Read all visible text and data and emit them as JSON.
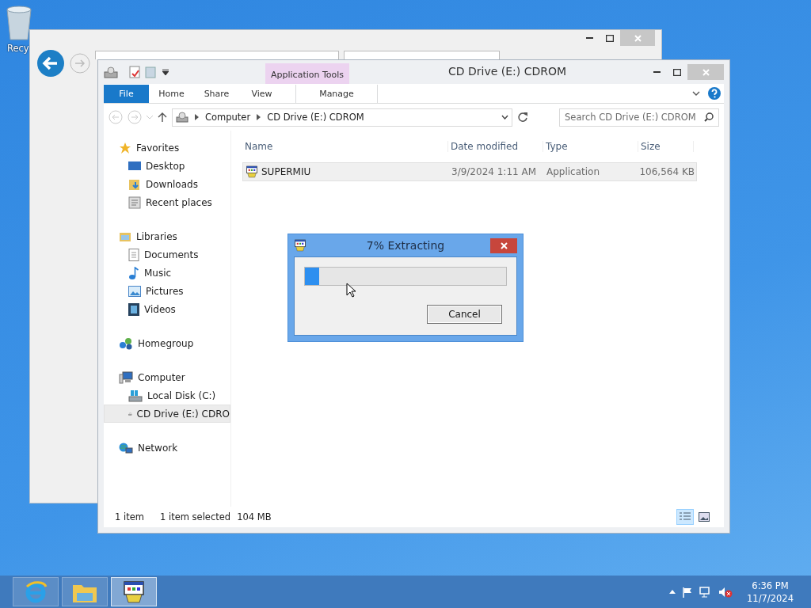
{
  "desktop": {
    "icon_label": "Recy"
  },
  "explorer": {
    "title": "CD Drive (E:) CDROM",
    "context_group": "Application Tools",
    "ribbon_tabs": [
      {
        "label": "File",
        "kind": "file"
      },
      {
        "label": "Home",
        "kind": "tab"
      },
      {
        "label": "Share",
        "kind": "tab"
      },
      {
        "label": "View",
        "kind": "tab"
      },
      {
        "label": "Manage",
        "kind": "contextual"
      }
    ],
    "path": [
      "Computer",
      "CD Drive (E:) CDROM"
    ],
    "search": {
      "placeholder": "Search CD Drive (E:) CDROM"
    },
    "columns": [
      "Name",
      "Date modified",
      "Type",
      "Size"
    ],
    "rows": [
      {
        "name": "SUPERMIU",
        "date": "3/9/2024 1:11 AM",
        "type": "Application",
        "size": "106,564 KB",
        "selected": true
      }
    ],
    "sidebar": [
      {
        "label": "Favorites",
        "kind": "star",
        "selected": false,
        "children": [
          {
            "label": "Desktop",
            "kind": "desktop",
            "selected": false
          },
          {
            "label": "Downloads",
            "kind": "downloads",
            "selected": false
          },
          {
            "label": "Recent places",
            "kind": "recent",
            "selected": false
          }
        ]
      },
      {
        "label": "Libraries",
        "kind": "library",
        "selected": false,
        "children": [
          {
            "label": "Documents",
            "kind": "document",
            "selected": false
          },
          {
            "label": "Music",
            "kind": "music",
            "selected": false
          },
          {
            "label": "Pictures",
            "kind": "pictures",
            "selected": false
          },
          {
            "label": "Videos",
            "kind": "videos",
            "selected": false
          }
        ]
      },
      {
        "label": "Homegroup",
        "kind": "homegroup",
        "selected": false
      },
      {
        "label": "Computer",
        "kind": "computer",
        "selected": false,
        "children": [
          {
            "label": "Local Disk (C:)",
            "kind": "disk",
            "selected": false
          },
          {
            "label": "CD Drive (E:) CDRO",
            "kind": "cd",
            "selected": true
          }
        ]
      },
      {
        "label": "Network",
        "kind": "network",
        "selected": false
      }
    ],
    "status": [
      "1 item",
      "1 item selected",
      "104 MB"
    ],
    "view_buttons": [
      {
        "kind": "details",
        "selected": true
      },
      {
        "kind": "tiles",
        "selected": false
      }
    ]
  },
  "dialog": {
    "title": "7% Extracting",
    "level": 0.07,
    "button": "Cancel"
  },
  "taskbar": {
    "apps": [
      {
        "kind": "browser",
        "selected": false
      },
      {
        "kind": "folder",
        "selected": false
      },
      {
        "kind": "installer",
        "selected": true
      }
    ],
    "time": "6:36 PM",
    "date": "11/7/2024"
  }
}
